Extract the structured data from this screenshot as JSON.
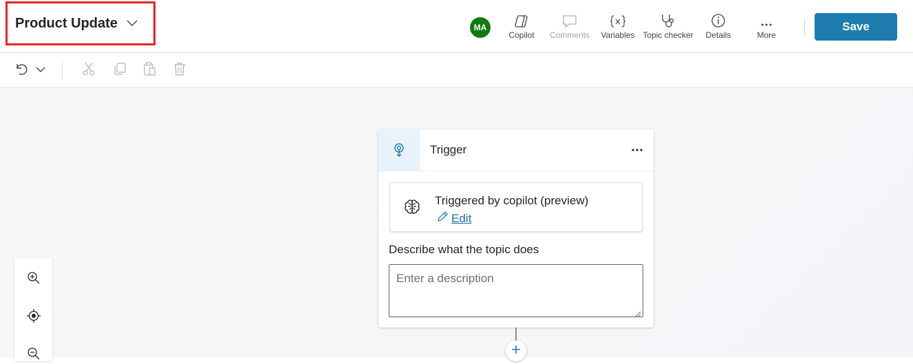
{
  "header": {
    "topic_title": "Product Update",
    "avatar_initials": "MA",
    "avatar_color": "#0f7b0f",
    "tools": [
      {
        "label": "Copilot",
        "icon": "copilot-icon",
        "enabled": true
      },
      {
        "label": "Comments",
        "icon": "comment-icon",
        "enabled": false
      },
      {
        "label": "Variables",
        "icon": "variables-icon",
        "enabled": true
      },
      {
        "label": "Topic checker",
        "icon": "stethoscope-icon",
        "enabled": true
      },
      {
        "label": "Details",
        "icon": "info-icon",
        "enabled": true
      },
      {
        "label": "More",
        "icon": "more-icon",
        "enabled": true
      }
    ],
    "save_label": "Save",
    "save_color": "#1d7bae",
    "highlight_color": "#e6232a"
  },
  "toolbar": {
    "items": [
      "undo-icon",
      "chevron-down-icon",
      "cut-icon",
      "copy-icon",
      "paste-icon",
      "delete-icon"
    ]
  },
  "trigger_node": {
    "title": "Trigger",
    "trigger_text": "Triggered by copilot (preview)",
    "edit_label": "Edit",
    "description_label": "Describe what the topic does",
    "description_placeholder": "Enter a description",
    "description_value": ""
  },
  "zoom": {
    "items": [
      "zoom-in-icon",
      "recenter-icon",
      "zoom-out-icon"
    ]
  }
}
